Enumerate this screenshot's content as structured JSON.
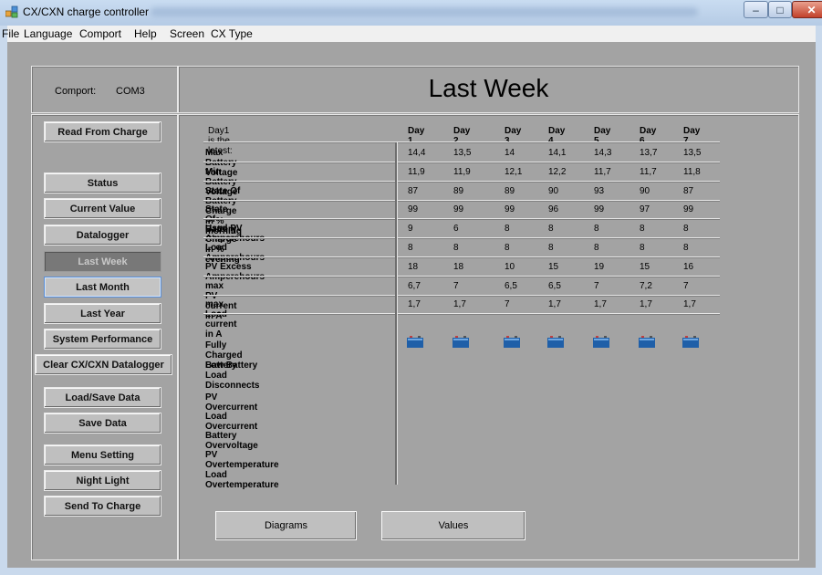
{
  "window": {
    "title": "CX/CXN charge controller",
    "controls": {
      "minimize": "–",
      "maximize": "□",
      "close": "✕"
    }
  },
  "menu": [
    "File",
    "Language",
    "Comport",
    "Help",
    "Screen",
    "CX Type"
  ],
  "comport": {
    "label": "Comport:",
    "value": "COM3"
  },
  "page_title": "Last Week",
  "sidebar": {
    "read": "Read From Charge",
    "status": "Status",
    "current_value": "Current Value",
    "datalogger": "Datalogger",
    "last_week": "Last Week",
    "last_month": "Last Month",
    "last_year": "Last Year",
    "system_performance": "System Performance",
    "clear_datalogger": "Clear CX/CXN Datalogger",
    "load_save": "Load/Save Data",
    "save_data": "Save Data",
    "menu_setting": "Menu Setting",
    "night_light": "Night Light",
    "send_to_charge": "Send To Charge"
  },
  "table": {
    "note": "Day1 is the latest:",
    "days": [
      "Day 1",
      "Day 2",
      "Day 3",
      "Day 4",
      "Day 5",
      "Day 6",
      "Day 7"
    ],
    "rows": [
      {
        "label": "Max Battery Voltage",
        "values": [
          "14,4",
          "13,5",
          "14",
          "14,1",
          "14,3",
          "13,7",
          "13,5"
        ]
      },
      {
        "label": "Min Battery Voltage",
        "values": [
          "11,9",
          "11,9",
          "12,1",
          "12,2",
          "11,7",
          "11,7",
          "11,8"
        ]
      },
      {
        "label": "State Of Battery Charge in % morning",
        "values": [
          "87",
          "89",
          "89",
          "90",
          "93",
          "90",
          "87"
        ]
      },
      {
        "label": "State Of Battery Charge in % evening",
        "values": [
          "99",
          "99",
          "99",
          "96",
          "99",
          "97",
          "99"
        ]
      },
      {
        "label": "Used PV Amperehours",
        "values": [
          "9",
          "6",
          "8",
          "8",
          "8",
          "8",
          "8"
        ]
      },
      {
        "label": "Load Amperehours",
        "values": [
          "8",
          "8",
          "8",
          "8",
          "8",
          "8",
          "8"
        ]
      },
      {
        "label": "PV Excess Amperehours",
        "values": [
          "18",
          "18",
          "10",
          "15",
          "19",
          "15",
          "16"
        ]
      },
      {
        "label": "max PV current in A",
        "values": [
          "6,7",
          "7",
          "6,5",
          "6,5",
          "7",
          "7,2",
          "7"
        ]
      },
      {
        "label": "max Load current in A",
        "values": [
          "1,7",
          "1,7",
          "7",
          "1,7",
          "1,7",
          "1,7",
          "1,7"
        ]
      }
    ],
    "event_labels": {
      "fully_charged": "Fully Charged Battery",
      "low_battery": "Low Battery Load Disconnects",
      "pv_overcurrent": "PV Overcurrent",
      "load_overcurrent": "Load Overcurrent",
      "battery_overvoltage": "Battery Overvoltage",
      "pv_overtemperature": "PV Overtemperature",
      "load_overtemperature": "Load Overtemperature"
    },
    "fully_charged_days": [
      true,
      true,
      true,
      true,
      true,
      true,
      true
    ],
    "icon": "battery-icon",
    "icon_color": "#1f5fa8"
  },
  "buttons": {
    "diagrams": "Diagrams",
    "values": "Values"
  }
}
